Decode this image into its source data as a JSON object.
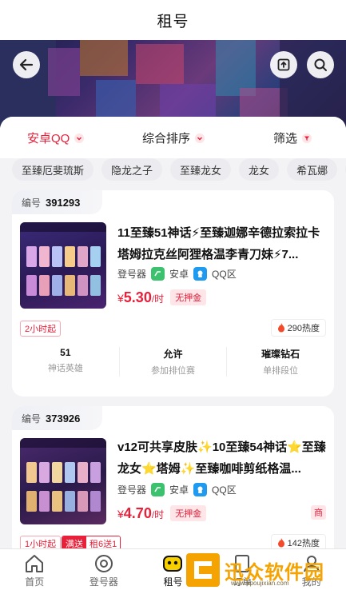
{
  "header": {
    "title": "租号"
  },
  "filters": {
    "platform": "安卓QQ",
    "sort": "综合排序",
    "filter": "筛选"
  },
  "chips": [
    "至臻厄斐琉斯",
    "隐龙之子",
    "至臻龙女",
    "龙女",
    "希瓦娜",
    "至臻"
  ],
  "listings": [
    {
      "id_label": "编号",
      "id": "391293",
      "title": "11至臻51神话⚡至臻迦娜辛德拉索拉卡塔姆拉克丝阿狸格温李青刀妹⚡7...",
      "login_label": "登号器",
      "os_label": "安卓",
      "zone_label": "QQ区",
      "price_prefix": "¥",
      "price": "5.30",
      "price_unit": "/时",
      "deposit_tag": "无押金",
      "time_tag": "2小时起",
      "heat": "290热度",
      "stats": [
        {
          "value": "51",
          "label": "神话英雄"
        },
        {
          "value": "允许",
          "label": "参加排位赛"
        },
        {
          "value": "璀璨钻石",
          "label": "单排段位"
        }
      ]
    },
    {
      "id_label": "编号",
      "id": "373926",
      "title": "v12可共享皮肤✨10至臻54神话⭐至臻龙女⭐塔姆✨至臻咖啡剪纸格温...",
      "login_label": "登号器",
      "os_label": "安卓",
      "zone_label": "QQ区",
      "price_prefix": "¥",
      "price": "4.70",
      "price_unit": "/时",
      "deposit_tag": "无押金",
      "side_tag": "商",
      "time_tag": "1小时起",
      "promo_tag_a": "满送",
      "promo_tag_b": "租6送1",
      "heat": "142热度"
    }
  ],
  "tabbar": {
    "items": [
      {
        "label": "首页",
        "icon": "home-icon"
      },
      {
        "label": "登号器",
        "icon": "login-tool-icon"
      },
      {
        "label": "租号",
        "icon": "gamepad-icon"
      },
      {
        "label": "订单",
        "icon": "order-icon"
      },
      {
        "label": "我的",
        "icon": "profile-icon"
      }
    ]
  },
  "watermark": {
    "text": "迅众软件园",
    "url": "www.apoujixian.com"
  },
  "colors": {
    "accent": "#e8203a",
    "wechat_green": "#3cc26e",
    "qq_blue": "#1e9bf0"
  }
}
